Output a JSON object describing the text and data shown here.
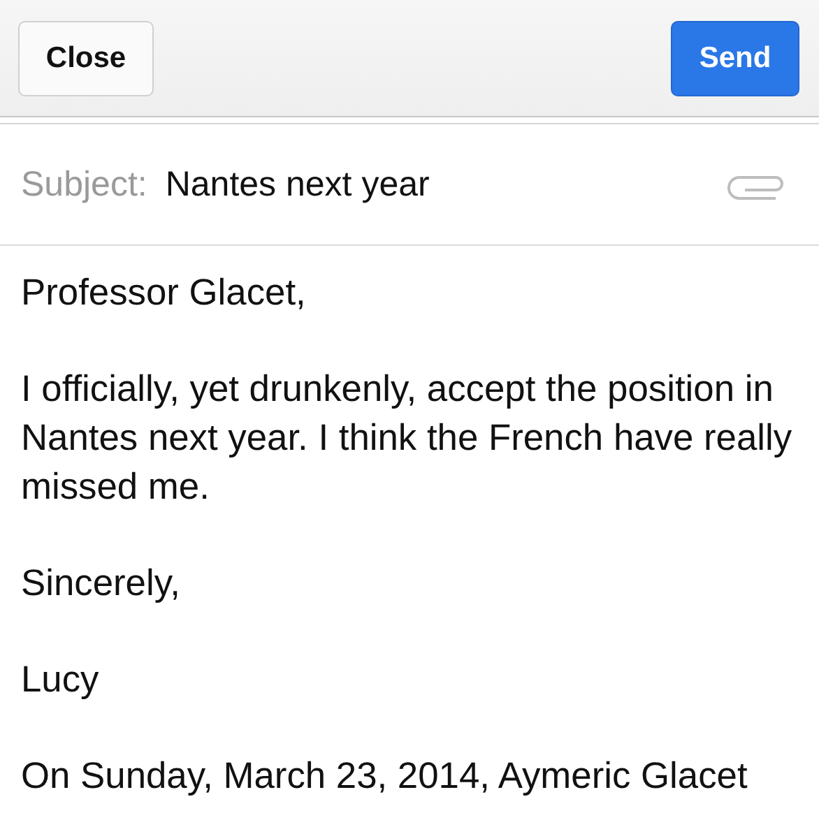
{
  "toolbar": {
    "close_button": "Close",
    "send_button": "Send"
  },
  "subject": {
    "label": "Subject:",
    "value": "Nantes next year"
  },
  "body": [
    "Professor Glacet,",
    "I officially, yet drunkenly, accept the position in Nantes next year. I think the French have really missed me.",
    "Sincerely,",
    "Lucy",
    "On Sunday, March 23, 2014, Aymeric Glacet"
  ]
}
